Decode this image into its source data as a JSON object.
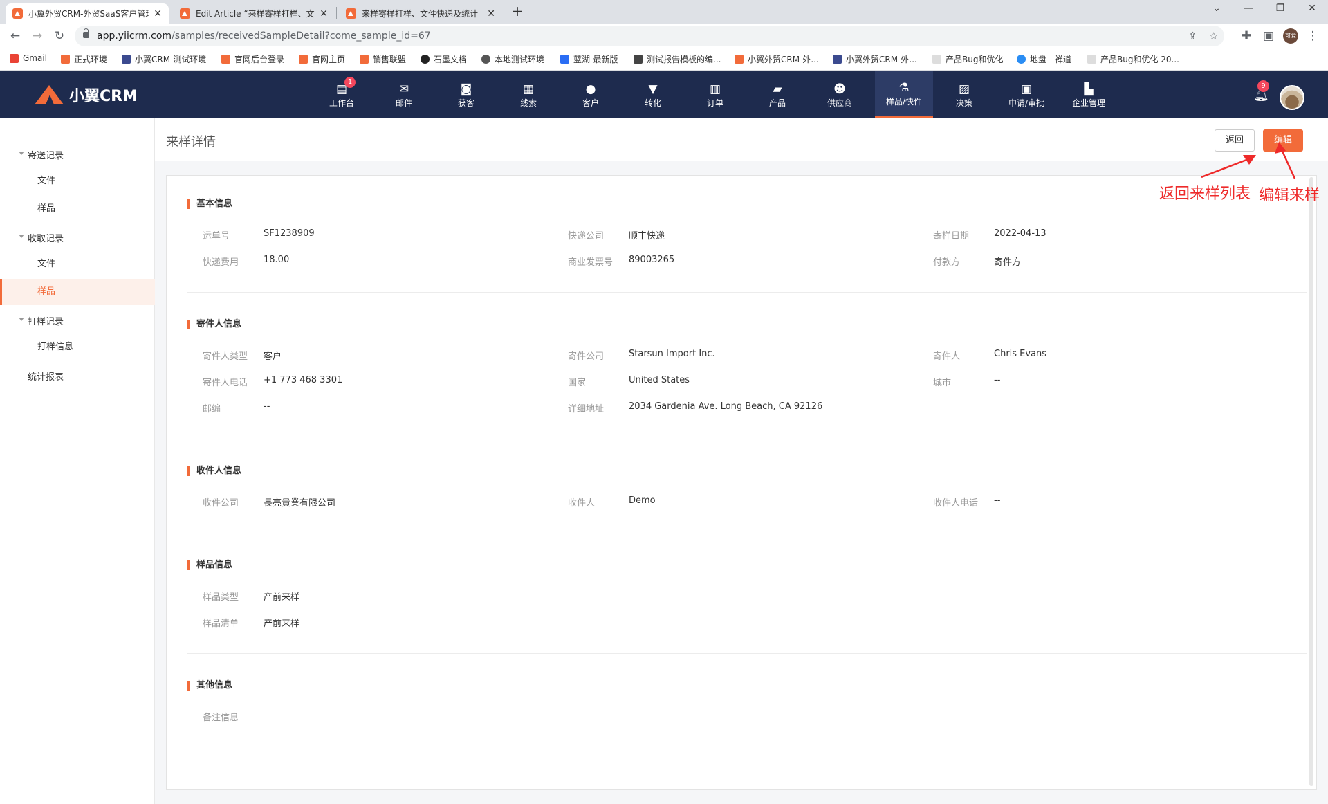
{
  "browser": {
    "tabs": [
      {
        "title": "小翼外贸CRM-外贸SaaS客户管理"
      },
      {
        "title": "Edit Article “来样寄样打样、文件"
      },
      {
        "title": "来样寄样打样、文件快递及统计"
      }
    ],
    "new_tab": "+",
    "url_host": "app.yiicrm.com",
    "url_path": "/samples/receivedSampleDetail?come_sample_id=67",
    "profile": "可爱",
    "bookmarks": [
      "Gmail",
      "正式环境",
      "小翼CRM-测试环境",
      "官网后台登录",
      "官网主页",
      "销售联盟",
      "石墨文档",
      "本地测试环境",
      "蓝湖-最新版",
      "测试报告模板的编...",
      "小翼外贸CRM-外...",
      "小翼外贸CRM-外...",
      "产品Bug和优化",
      "地盘 - 禅道",
      "产品Bug和优化 20..."
    ]
  },
  "app": {
    "brand": "小翼CRM",
    "nav": [
      {
        "label": "工作台",
        "icon": "workbench-icon",
        "badge": "1"
      },
      {
        "label": "邮件",
        "icon": "mail-icon"
      },
      {
        "label": "获客",
        "icon": "acquire-icon"
      },
      {
        "label": "线索",
        "icon": "lead-icon"
      },
      {
        "label": "客户",
        "icon": "customer-icon"
      },
      {
        "label": "转化",
        "icon": "funnel-icon"
      },
      {
        "label": "订单",
        "icon": "order-icon"
      },
      {
        "label": "产品",
        "icon": "product-icon"
      },
      {
        "label": "供应商",
        "icon": "supplier-icon"
      },
      {
        "label": "样品/快件",
        "icon": "flask-icon",
        "active": true
      },
      {
        "label": "决策",
        "icon": "chart-icon"
      },
      {
        "label": "申请/审批",
        "icon": "approval-icon"
      },
      {
        "label": "企业管理",
        "icon": "building-icon"
      }
    ],
    "notification_count": "9"
  },
  "sidebar": {
    "groups": [
      {
        "label": "寄送记录",
        "items": [
          "文件",
          "样品"
        ]
      },
      {
        "label": "收取记录",
        "items": [
          "文件",
          "样品"
        ]
      },
      {
        "label": "打样记录",
        "items": [
          "打样信息"
        ]
      }
    ],
    "root_item": "统计报表",
    "active": "收取记录/样品"
  },
  "page": {
    "title": "来样详情",
    "back_button": "返回",
    "edit_button": "编辑"
  },
  "sections": {
    "basic": {
      "title": "基本信息",
      "fields": [
        {
          "label": "运单号",
          "value": "SF1238909"
        },
        {
          "label": "快递公司",
          "value": "顺丰快递"
        },
        {
          "label": "寄样日期",
          "value": "2022-04-13"
        },
        {
          "label": "快递费用",
          "value": "18.00"
        },
        {
          "label": "商业发票号",
          "value": "89003265"
        },
        {
          "label": "付款方",
          "value": "寄件方"
        }
      ]
    },
    "sender": {
      "title": "寄件人信息",
      "fields": [
        {
          "label": "寄件人类型",
          "value": "客户"
        },
        {
          "label": "寄件公司",
          "value": "Starsun Import Inc."
        },
        {
          "label": "寄件人",
          "value": "Chris Evans"
        },
        {
          "label": "寄件人电话",
          "value": "+1 773 468 3301"
        },
        {
          "label": "国家",
          "value": "United States"
        },
        {
          "label": "城市",
          "value": "--"
        },
        {
          "label": "邮编",
          "value": "--"
        },
        {
          "label": "详细地址",
          "value": "2034 Gardenia Ave. Long Beach, CA 92126"
        }
      ]
    },
    "receiver": {
      "title": "收件人信息",
      "fields": [
        {
          "label": "收件公司",
          "value": "長亮貴業有限公司"
        },
        {
          "label": "收件人",
          "value": "Demo"
        },
        {
          "label": "收件人电话",
          "value": "--"
        }
      ]
    },
    "sample": {
      "title": "样品信息",
      "fields": [
        {
          "label": "样品类型",
          "value": "产前来样"
        },
        {
          "label": "样品清单",
          "value": "产前来样"
        }
      ]
    },
    "other": {
      "title": "其他信息",
      "fields": [
        {
          "label": "备注信息",
          "value": ""
        }
      ]
    }
  },
  "annotations": {
    "back": "返回来样列表",
    "edit": "编辑来样",
    "color": "#ee2a2a"
  },
  "colors": {
    "accent": "#f26b3a",
    "appbar": "#1e2b4e",
    "badge": "#f5475d"
  }
}
